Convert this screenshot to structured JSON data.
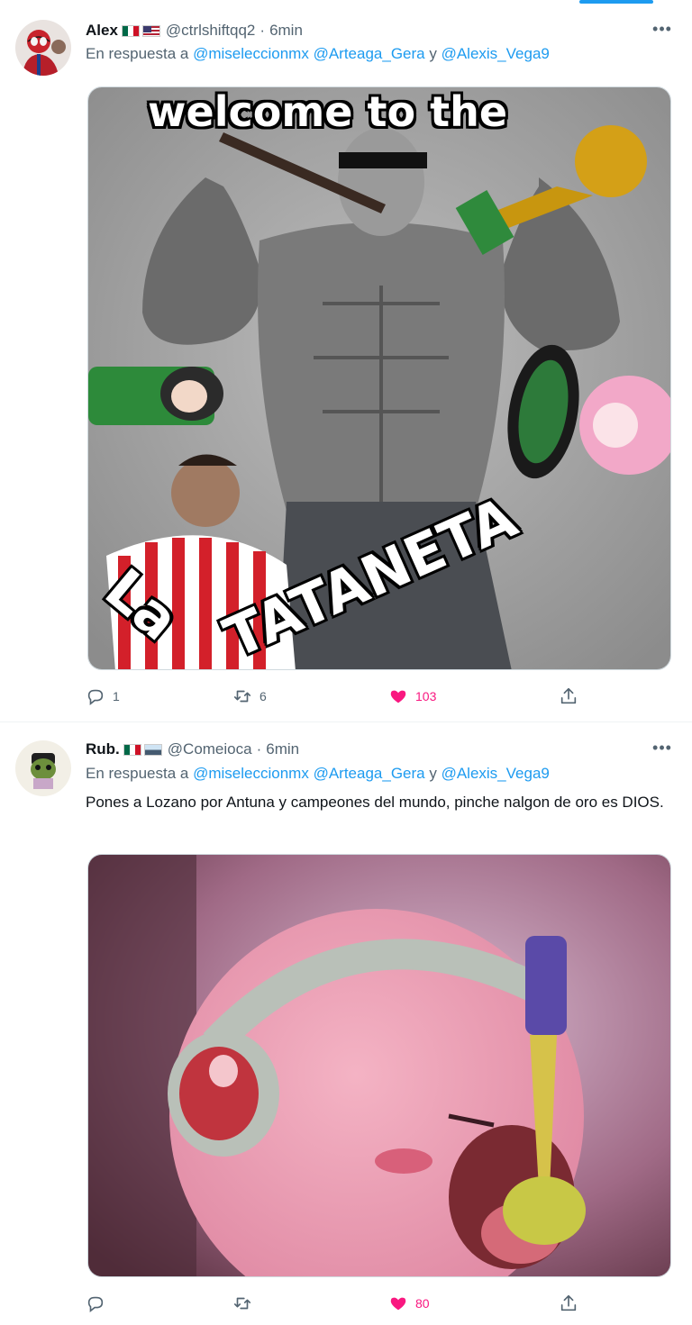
{
  "tweets": [
    {
      "author_name": "Alex",
      "handle": "@ctrlshiftqq2",
      "separator": "·",
      "time": "6min",
      "reply_prefix": "En respuesta a",
      "reply_mention_1": "@miseleccionmx",
      "reply_mention_2": "@Arteaga_Gera",
      "reply_and": "y",
      "reply_mention_3": "@Alexis_Vega9",
      "media_caption_top": "welcome to the",
      "media_caption_la": "La",
      "media_caption_main": "TATANETA",
      "replies": "1",
      "retweets": "6",
      "likes": "103",
      "liked": true
    },
    {
      "author_name": "Rub.",
      "handle": "@Comeioca",
      "separator": "·",
      "time": "6min",
      "reply_prefix": "En respuesta a",
      "reply_mention_1": "@miseleccionmx",
      "reply_mention_2": "@Arteaga_Gera",
      "reply_and": "y",
      "reply_mention_3": "@Alexis_Vega9",
      "text": "Pones a Lozano por Antuna y campeones del mundo, pinche nalgon de oro es DIOS.",
      "replies": "",
      "retweets": "",
      "likes": "80",
      "liked": true
    }
  ],
  "colors": {
    "accent": "#1d9bf0",
    "like": "#f91880",
    "muted": "#536471"
  },
  "icons": [
    "reply-icon",
    "retweet-icon",
    "heart-icon",
    "share-icon",
    "more-icon"
  ]
}
